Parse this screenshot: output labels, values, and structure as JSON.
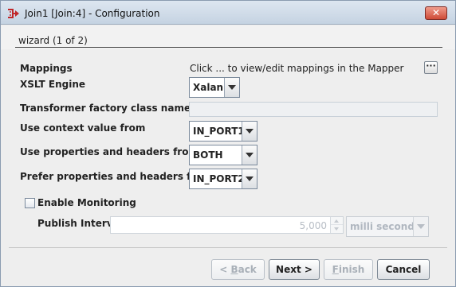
{
  "window": {
    "title": "Join1 [Join:4] - Configuration",
    "close_glyph": "✕",
    "app_icon": "join-component-icon",
    "close_icon": "close-icon"
  },
  "wizard": {
    "step_title": "wizard (1 of 2)"
  },
  "form": {
    "mappings": {
      "label": "Mappings",
      "hint": "Click ... to view/edit mappings in the Mapper",
      "button_glyph": "···",
      "button_icon": "ellipsis-icon"
    },
    "xslt_engine": {
      "label": "XSLT Engine",
      "value": "Xalan"
    },
    "transformer_factory": {
      "label": "Transformer factory class name",
      "value": ""
    },
    "context_value": {
      "label": "Use context value from",
      "value": "IN_PORT1"
    },
    "properties_headers": {
      "label": "Use properties and headers from",
      "value": "BOTH"
    },
    "prefer_properties": {
      "label": "Prefer properties and headers from",
      "value": "IN_PORT2"
    },
    "enable_monitoring": {
      "label": "Enable Monitoring",
      "checked": false
    },
    "publish_interval": {
      "label": "Publish Interval",
      "value": "5,000",
      "unit": "milli seconds"
    }
  },
  "footer": {
    "back": {
      "prefix": "< ",
      "mnemonic": "B",
      "rest": "ack"
    },
    "next": {
      "label": "Next >"
    },
    "finish": {
      "mnemonic": "F",
      "rest": "inish"
    },
    "cancel": {
      "label": "Cancel"
    }
  },
  "colors": {
    "titlebar": "#c9d6e4",
    "close_button": "#d65a45",
    "window_bg": "#eeeeee"
  }
}
